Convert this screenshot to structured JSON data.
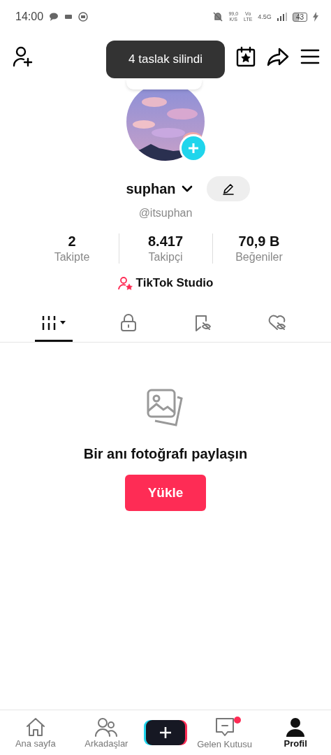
{
  "status_bar": {
    "time": "14:00",
    "speed": "99,0",
    "speed_unit": "K/S",
    "volte_top": "Vo",
    "volte_bottom": "LTE",
    "network": "4.5G",
    "battery": "43"
  },
  "toast": "4 taslak silindi",
  "note_bubble": {
    "kind": "note"
  },
  "profile": {
    "username": "suphan",
    "handle": "@itsuphan"
  },
  "stats": [
    {
      "value": "2",
      "label": "Takipte"
    },
    {
      "value": "8.417",
      "label": "Takipçi"
    },
    {
      "value": "70,9 B",
      "label": "Beğeniler"
    }
  ],
  "studio_link": "TikTok Studio",
  "tabs": [
    {
      "kind": "grid",
      "selected": true
    },
    {
      "kind": "lock",
      "selected": false
    },
    {
      "kind": "saved",
      "selected": false
    },
    {
      "kind": "liked",
      "selected": false
    }
  ],
  "empty_state": {
    "message": "Bir anı fotoğrafı paylaşın",
    "button": "Yükle"
  },
  "bottom_nav": [
    {
      "kind": "home",
      "label": "Ana sayfa",
      "selected": false,
      "badge": false
    },
    {
      "kind": "friends",
      "label": "Arkadaşlar",
      "selected": false,
      "badge": false
    },
    {
      "kind": "create"
    },
    {
      "kind": "inbox",
      "label": "Gelen Kutusu",
      "selected": false,
      "badge": true
    },
    {
      "kind": "profile",
      "label": "Profil",
      "selected": true,
      "badge": false
    }
  ]
}
